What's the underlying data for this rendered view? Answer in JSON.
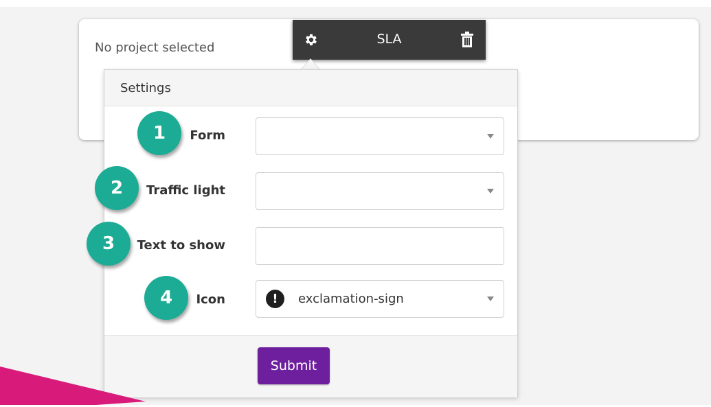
{
  "widget": {
    "status_text": "No project selected"
  },
  "toolbar": {
    "title": "SLA",
    "settings_icon": "gear-icon",
    "delete_icon": "trash-icon"
  },
  "settings": {
    "header": "Settings",
    "fields": [
      {
        "badge": "1",
        "label": "Form",
        "type": "select",
        "value": ""
      },
      {
        "badge": "2",
        "label": "Traffic light",
        "type": "select",
        "value": ""
      },
      {
        "badge": "3",
        "label": "Text to show",
        "type": "text",
        "value": ""
      },
      {
        "badge": "4",
        "label": "Icon",
        "type": "select",
        "value": "exclamation-sign",
        "icon": "exclamation-sign-icon"
      }
    ],
    "submit_label": "Submit"
  },
  "colors": {
    "badge": "#1cac95",
    "submit": "#6e1f9e",
    "toolbar": "#3a3a3a",
    "accent_shape": "#d81b7a"
  }
}
